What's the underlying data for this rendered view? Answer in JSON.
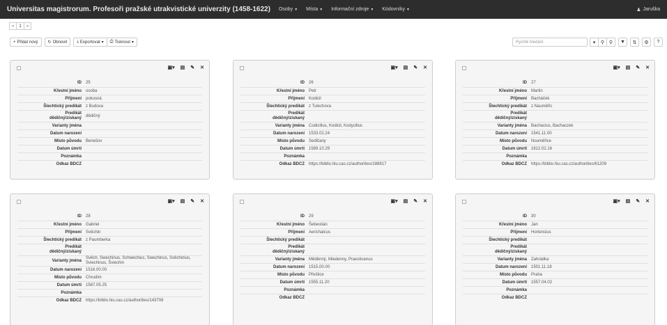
{
  "navbar": {
    "title": "Universitas magistrorum. Profesoři pražské utrakvistické univerzity (1458-1622)",
    "menu": [
      "Osoby",
      "Místa",
      "Informační zdroje",
      "Kódovníky"
    ],
    "user": "Jaruška"
  },
  "pager": {
    "prev": "«",
    "current": "1",
    "next": "»"
  },
  "toolbar": {
    "add": "Přidat nový",
    "refresh": "Obnovit",
    "export": "Exportovat",
    "print": "Tisknout"
  },
  "search": {
    "placeholder": "Rychlé hledání"
  },
  "labels": {
    "id": "ID",
    "first_name": "Křestní jméno",
    "surname": "Příjmení",
    "noble": "Šlechtický predikát",
    "predicate1": "Predikát",
    "predicate2": "dědičný/získaný",
    "variants": "Varianty jména",
    "birth": "Datum narození",
    "origin": "Místo původu",
    "death": "Datum úmrtí",
    "note": "Poznámka",
    "bdcz": "Odkaz BDCZ"
  },
  "cards": [
    {
      "id": "25",
      "first_name": "osoba",
      "surname": "pokusná",
      "noble": "z Budova",
      "predicate": "dědičný",
      "variants": "",
      "birth": "",
      "origin": "Benešov",
      "death": "",
      "note": "",
      "bdcz": ""
    },
    {
      "id": "26",
      "first_name": "Petr",
      "surname": "Kodicil",
      "noble": "z Tulechova",
      "predicate": "",
      "variants": "Codicillus, Kodicil, Kodycillus",
      "birth": "1533.02.24",
      "origin": "Sedlčany",
      "death": "1589.10.29",
      "note": "",
      "bdcz": "https://biblio.hiu.cas.cz/authorities/188817"
    },
    {
      "id": "27",
      "first_name": "Martin",
      "surname": "Bacháček",
      "noble": "z Nauměřic",
      "predicate": "",
      "variants": "Bachacius, Bachaczek",
      "birth": "1541.11.00",
      "origin": "Nouměřice",
      "death": "1612.02.16",
      "note": "",
      "bdcz": "https://biblio.hiu.cas.cz/authorities/61209"
    },
    {
      "id": "28",
      "first_name": "Gabriel",
      "surname": "Svěchin",
      "noble": "z Paumberka",
      "predicate": "",
      "variants": "Svěch, Swechinus, Schwechius, Swechinus, Svěchinius, Sviechinus, Šviechin",
      "birth": "1516.00.00",
      "origin": "Chrudim",
      "death": "1587.05.25",
      "note": "",
      "bdcz": "https://biblio.hiu.cas.cz/authorities/143708"
    },
    {
      "id": "29",
      "first_name": "Šebestián",
      "surname": "Aerichalcus",
      "noble": "",
      "predicate": "",
      "variants": "Měděnný, Miedenny, Praesticenus",
      "birth": "1515.00.00",
      "origin": "Přeštice",
      "death": "1555.11.20",
      "note": "",
      "bdcz": ""
    },
    {
      "id": "30",
      "first_name": "Jan",
      "surname": "Hortensius",
      "noble": "",
      "predicate": "",
      "variants": "Zahrádka",
      "birth": "1501.11.18",
      "origin": "Praha",
      "death": "1557.04.02",
      "note": "",
      "bdcz": ""
    }
  ]
}
